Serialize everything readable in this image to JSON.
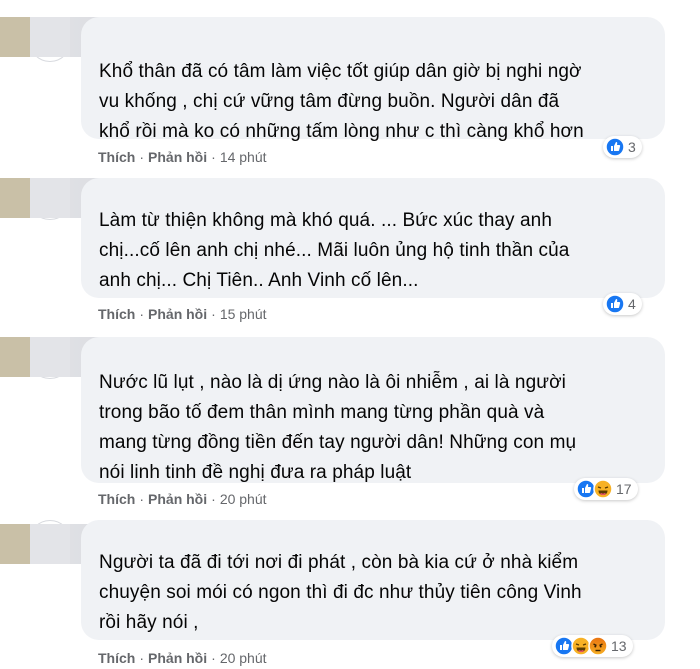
{
  "comments": [
    {
      "text_lines": [
        "Khổ thân đã có tâm làm việc tốt giúp dân giờ bị nghi ngờ",
        "vu khống , chị cứ vững tâm đừng buồn. Người dân đã",
        "khổ rồi mà ko có những tấm lòng như c thì càng khổ hơn"
      ],
      "like_label": "Thích",
      "reply_label": "Phản hồi",
      "time": "14 phút",
      "reaction_count": "3",
      "reaction_icons": [
        "like-icon"
      ]
    },
    {
      "text_lines": [
        "Làm từ thiện không mà khó quá. ... Bức xúc thay anh",
        "chị...cố lên anh chị nhé... Mãi luôn ủng hộ tinh thần của",
        "anh chị... Chị Tiên.. Anh Vinh cố lên..."
      ],
      "like_label": "Thích",
      "reply_label": "Phản hồi",
      "time": "15 phút",
      "reaction_count": "4",
      "reaction_icons": [
        "like-icon"
      ]
    },
    {
      "text_lines": [
        "Nước lũ lụt , nào là dị ứng nào là ôi nhiễm , ai là người",
        "trong bão tố đem thân mình mang từng phần quà và",
        "mang từng đồng tiền đến tay người dân! Những con mụ",
        "nói linh tinh đề nghị đưa ra pháp luật"
      ],
      "like_label": "Thích",
      "reply_label": "Phản hồi",
      "time": "20 phút",
      "reaction_count": "17",
      "reaction_icons": [
        "like-icon",
        "haha-icon"
      ]
    },
    {
      "text_lines": [
        "Người ta đã đi tới nơi đi phát , còn bà kia cứ ở nhà kiểm",
        "chuyện soi mói có ngon thì đi đc như thủy tiên công Vinh",
        "rồi hãy nói ,"
      ],
      "like_label": "Thích",
      "reply_label": "Phản hồi",
      "time": "20 phút",
      "reaction_count": "13",
      "reaction_icons": [
        "like-icon",
        "haha-icon",
        "angry-icon"
      ]
    }
  ],
  "colors": {
    "bubble_bg": "#f0f2f5",
    "like_blue": "#1877f2",
    "haha_yellow": "#f7b125",
    "angry_orange": "#e9710f",
    "meta_gray": "#65676b"
  }
}
